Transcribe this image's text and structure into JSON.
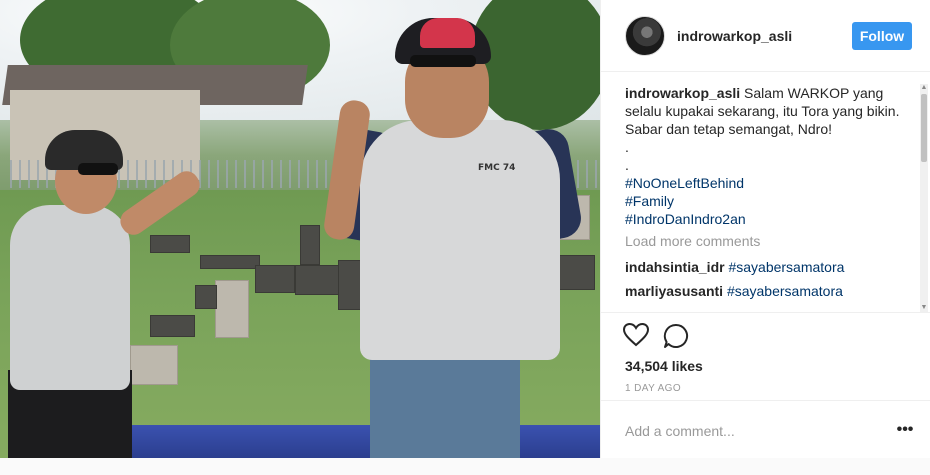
{
  "post": {
    "image_alt": "Two men laughing in a cemetery",
    "shirt_logo": "FMC 74"
  },
  "header": {
    "username": "indrowarkop_asli",
    "follow_label": "Follow",
    "follow_color": "#3897f0"
  },
  "caption": {
    "username": "indrowarkop_asli",
    "lines": [
      "Salam WARKOP yang",
      "selalu kupakai sekarang, itu Tora yang bikin.",
      "Sabar dan tetap semangat, Ndro!",
      ".",
      "."
    ],
    "hashtags": [
      "#NoOneLeftBehind",
      "#Family",
      "#IndroDanIndro2an"
    ]
  },
  "load_more_label": "Load more comments",
  "comments": [
    {
      "username": "indahsintia_idr",
      "text": "#sayabersamatora"
    },
    {
      "username": "marliyasusanti",
      "text": "#sayabersamatora"
    }
  ],
  "actions": {
    "like_icon": "heart-icon",
    "comment_icon": "comment-bubble-icon"
  },
  "likes_label": "34,504 likes",
  "date_label": "1 DAY AGO",
  "add_comment": {
    "placeholder": "Add a comment..."
  },
  "more_label": "•••"
}
